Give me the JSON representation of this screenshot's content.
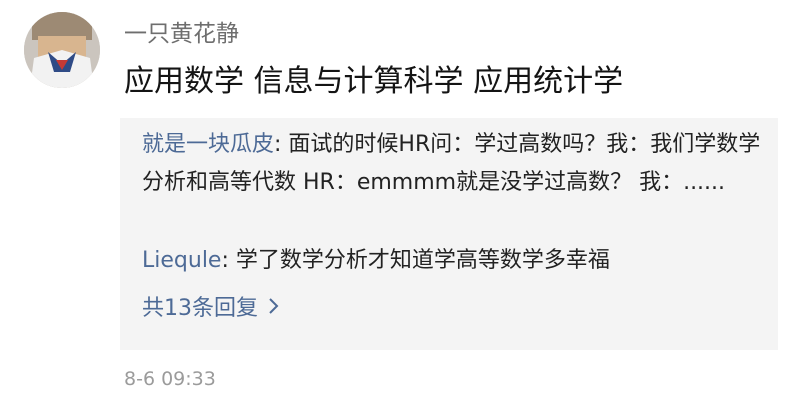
{
  "post": {
    "username": "一只黄花静",
    "content": "应用数学   信息与计算科学   应用统计学",
    "timestamp": "8-6 09:33"
  },
  "replies": [
    {
      "name": "就是一块瓜皮",
      "separator": ": ",
      "text": "面试的时候HR问：学过高数吗？我：我们学数学分析和高等代数 HR：emmmm就是没学过高数？ 我：......"
    },
    {
      "name": "Liequle",
      "separator": ": ",
      "text": "学了数学分析才知道学高等数学多幸福"
    }
  ],
  "more_replies": {
    "label": "共13条回复",
    "icon": "chevron-right-icon"
  },
  "colors": {
    "link": "#4d6a96",
    "reply_bg": "#f4f4f4",
    "timestamp": "#9b9b9b"
  }
}
